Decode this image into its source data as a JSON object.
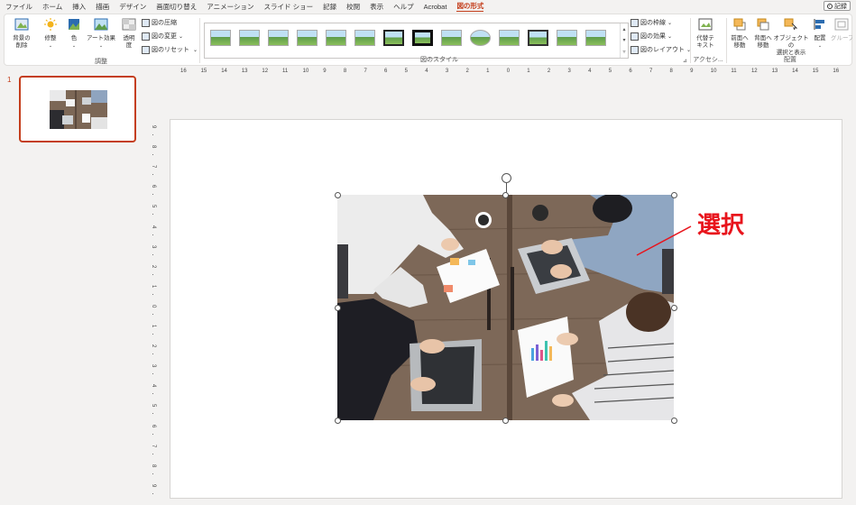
{
  "menu": {
    "tabs": [
      "ファイル",
      "ホーム",
      "挿入",
      "描画",
      "デザイン",
      "画面切り替え",
      "アニメーション",
      "スライド ショー",
      "記録",
      "校閲",
      "表示",
      "ヘルプ",
      "Acrobat",
      "図の形式"
    ],
    "active_tab": "図の形式",
    "record_label": "記録"
  },
  "ribbon": {
    "adjust": {
      "remove_bg": "背景の\n削除",
      "corrections": "修整",
      "color": "色",
      "artistic": "アート効果",
      "transparency": "透明\n度",
      "compress": "図の圧縮",
      "change": "図の変更",
      "reset": "図のリセット",
      "label": "調整"
    },
    "styles": {
      "border": "図の枠線",
      "effects": "図の効果",
      "layout": "図のレイアウト",
      "label": "図のスタイル"
    },
    "accessibility": {
      "alt_text": "代替テ\nキスト",
      "label": "アクセシ..."
    },
    "arrange": {
      "bring_forward": "前面へ\n移動",
      "send_backward": "背面へ\n移動",
      "selection_pane": "オブジェクトの\n選択と表示",
      "align": "配置",
      "group": "グループ化",
      "label": "配置"
    }
  },
  "slides": {
    "current_number": "1"
  },
  "ruler": {
    "h_ticks": [
      "16",
      "15",
      "14",
      "13",
      "12",
      "11",
      "10",
      "9",
      "8",
      "7",
      "6",
      "5",
      "4",
      "3",
      "2",
      "1",
      "0",
      "1",
      "2",
      "3",
      "4",
      "5",
      "6",
      "7",
      "8",
      "9",
      "10",
      "11",
      "12",
      "13",
      "14",
      "15",
      "16"
    ],
    "v_ticks": [
      "9",
      "8",
      "7",
      "6",
      "5",
      "4",
      "3",
      "2",
      "1",
      "0",
      "1",
      "2",
      "3",
      "4",
      "5",
      "6",
      "7",
      "8",
      "9"
    ]
  },
  "annotation": {
    "text": "選択",
    "color": "#e8141c"
  },
  "colors": {
    "accent": "#c43e1c"
  }
}
